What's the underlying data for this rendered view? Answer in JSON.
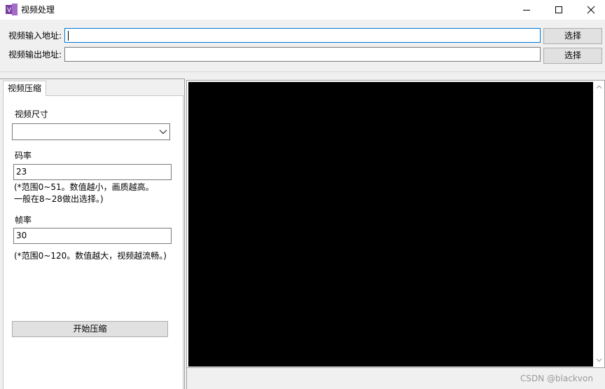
{
  "window": {
    "title": "视频处理",
    "icon": "purple-app-icon",
    "controls": [
      "minimize-icon",
      "maximize-icon",
      "close-icon"
    ]
  },
  "paths": {
    "input_label": "视频输入地址:",
    "input_value": "",
    "output_label": "视频输出地址:",
    "output_value": "",
    "browse_label": "选择"
  },
  "tabs": [
    {
      "label": "视频压缩",
      "selected": true
    }
  ],
  "compress": {
    "size_label": "视频尺寸",
    "size_value": "",
    "bitrate_label": "码率",
    "bitrate_value": "23",
    "bitrate_hint_line1": "(*范围0~51。数值越小，画质越高。",
    "bitrate_hint_line2": "一般在8~28做出选择。)",
    "framerate_label": "帧率",
    "framerate_value": "30",
    "framerate_hint": "(*范围0~120。数值越大，视频越流畅。)",
    "start_label": "开始压缩"
  },
  "watermark": "CSDN @blackvon",
  "colors": {
    "accent_focus": "#0078d7",
    "video_background": "#000000",
    "button_face": "#e1e1e1"
  }
}
